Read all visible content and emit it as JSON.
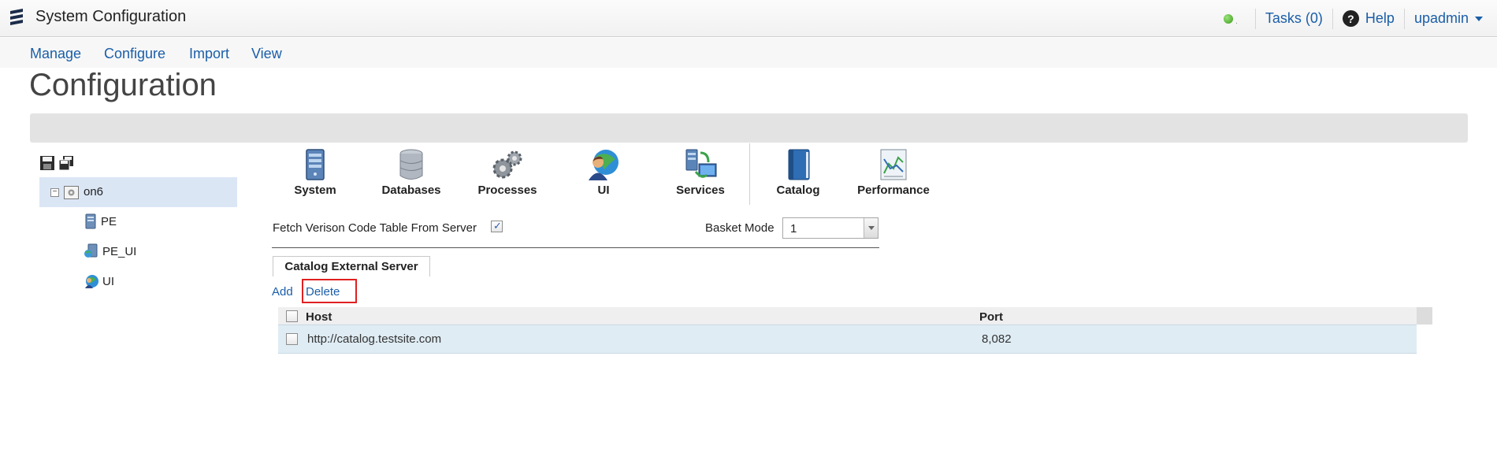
{
  "header": {
    "app_title": "System Configuration",
    "tasks_label": "Tasks (0)",
    "help_label": "Help",
    "user_label": "upadmin",
    "status_color": "#3a9a1a"
  },
  "menu": {
    "items": [
      "Manage",
      "Configure",
      "Import",
      "View"
    ]
  },
  "page": {
    "title": "Configuration"
  },
  "tree": {
    "root_label": "on6",
    "children": [
      "PE",
      "PE_UI",
      "UI"
    ]
  },
  "categories": [
    {
      "label": "System",
      "icon": "server-icon"
    },
    {
      "label": "Databases",
      "icon": "database-icon"
    },
    {
      "label": "Processes",
      "icon": "gears-icon"
    },
    {
      "label": "UI",
      "icon": "globe-user-icon"
    },
    {
      "label": "Services",
      "icon": "services-icon"
    },
    {
      "label": "Catalog",
      "icon": "book-icon"
    },
    {
      "label": "Performance",
      "icon": "chart-icon"
    }
  ],
  "form": {
    "fetch_label": "Fetch Verison Code Table From Server",
    "fetch_checked": true,
    "basket_label": "Basket Mode",
    "basket_value": "1"
  },
  "tab": {
    "label": "Catalog External Server"
  },
  "actions": {
    "add_label": "Add",
    "delete_label": "Delete"
  },
  "table": {
    "columns": [
      "Host",
      "Port"
    ],
    "rows": [
      {
        "host": "http://catalog.testsite.com",
        "port": "8,082"
      }
    ]
  }
}
